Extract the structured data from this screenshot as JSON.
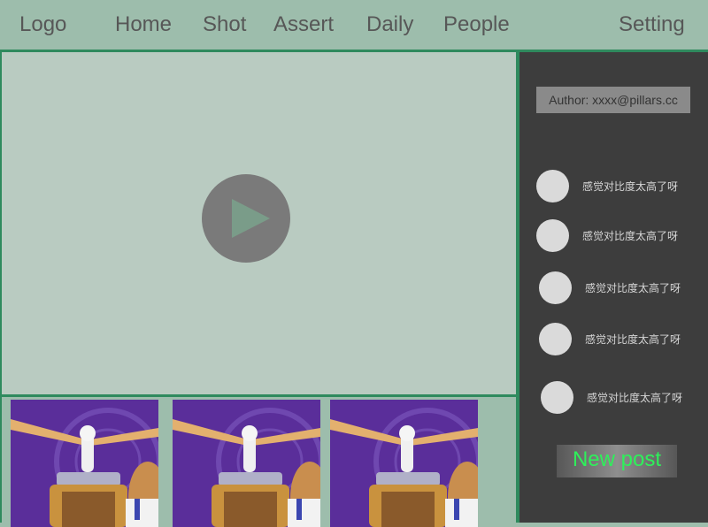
{
  "nav": {
    "logo": "Logo",
    "items": [
      "Home",
      "Shot",
      "Assert",
      "Daily",
      "People"
    ],
    "setting": "Setting"
  },
  "video": {
    "play_icon": "play-icon"
  },
  "sidebar": {
    "author": "Author: xxxx@pillars.cc",
    "comments": [
      {
        "text": "感觉对比度太高了呀"
      },
      {
        "text": "感觉对比度太高了呀"
      },
      {
        "text": "感觉对比度太高了呀"
      },
      {
        "text": "感觉对比度太高了呀"
      },
      {
        "text": "感觉对比度太高了呀"
      }
    ],
    "new_post": "New post"
  },
  "colors": {
    "nav_bg": "#9dbdac",
    "border": "#2f8a5e",
    "video_bg": "#b9cbc1",
    "sidebar_bg": "#3d3d3d",
    "new_post_text": "#2ef05a"
  }
}
